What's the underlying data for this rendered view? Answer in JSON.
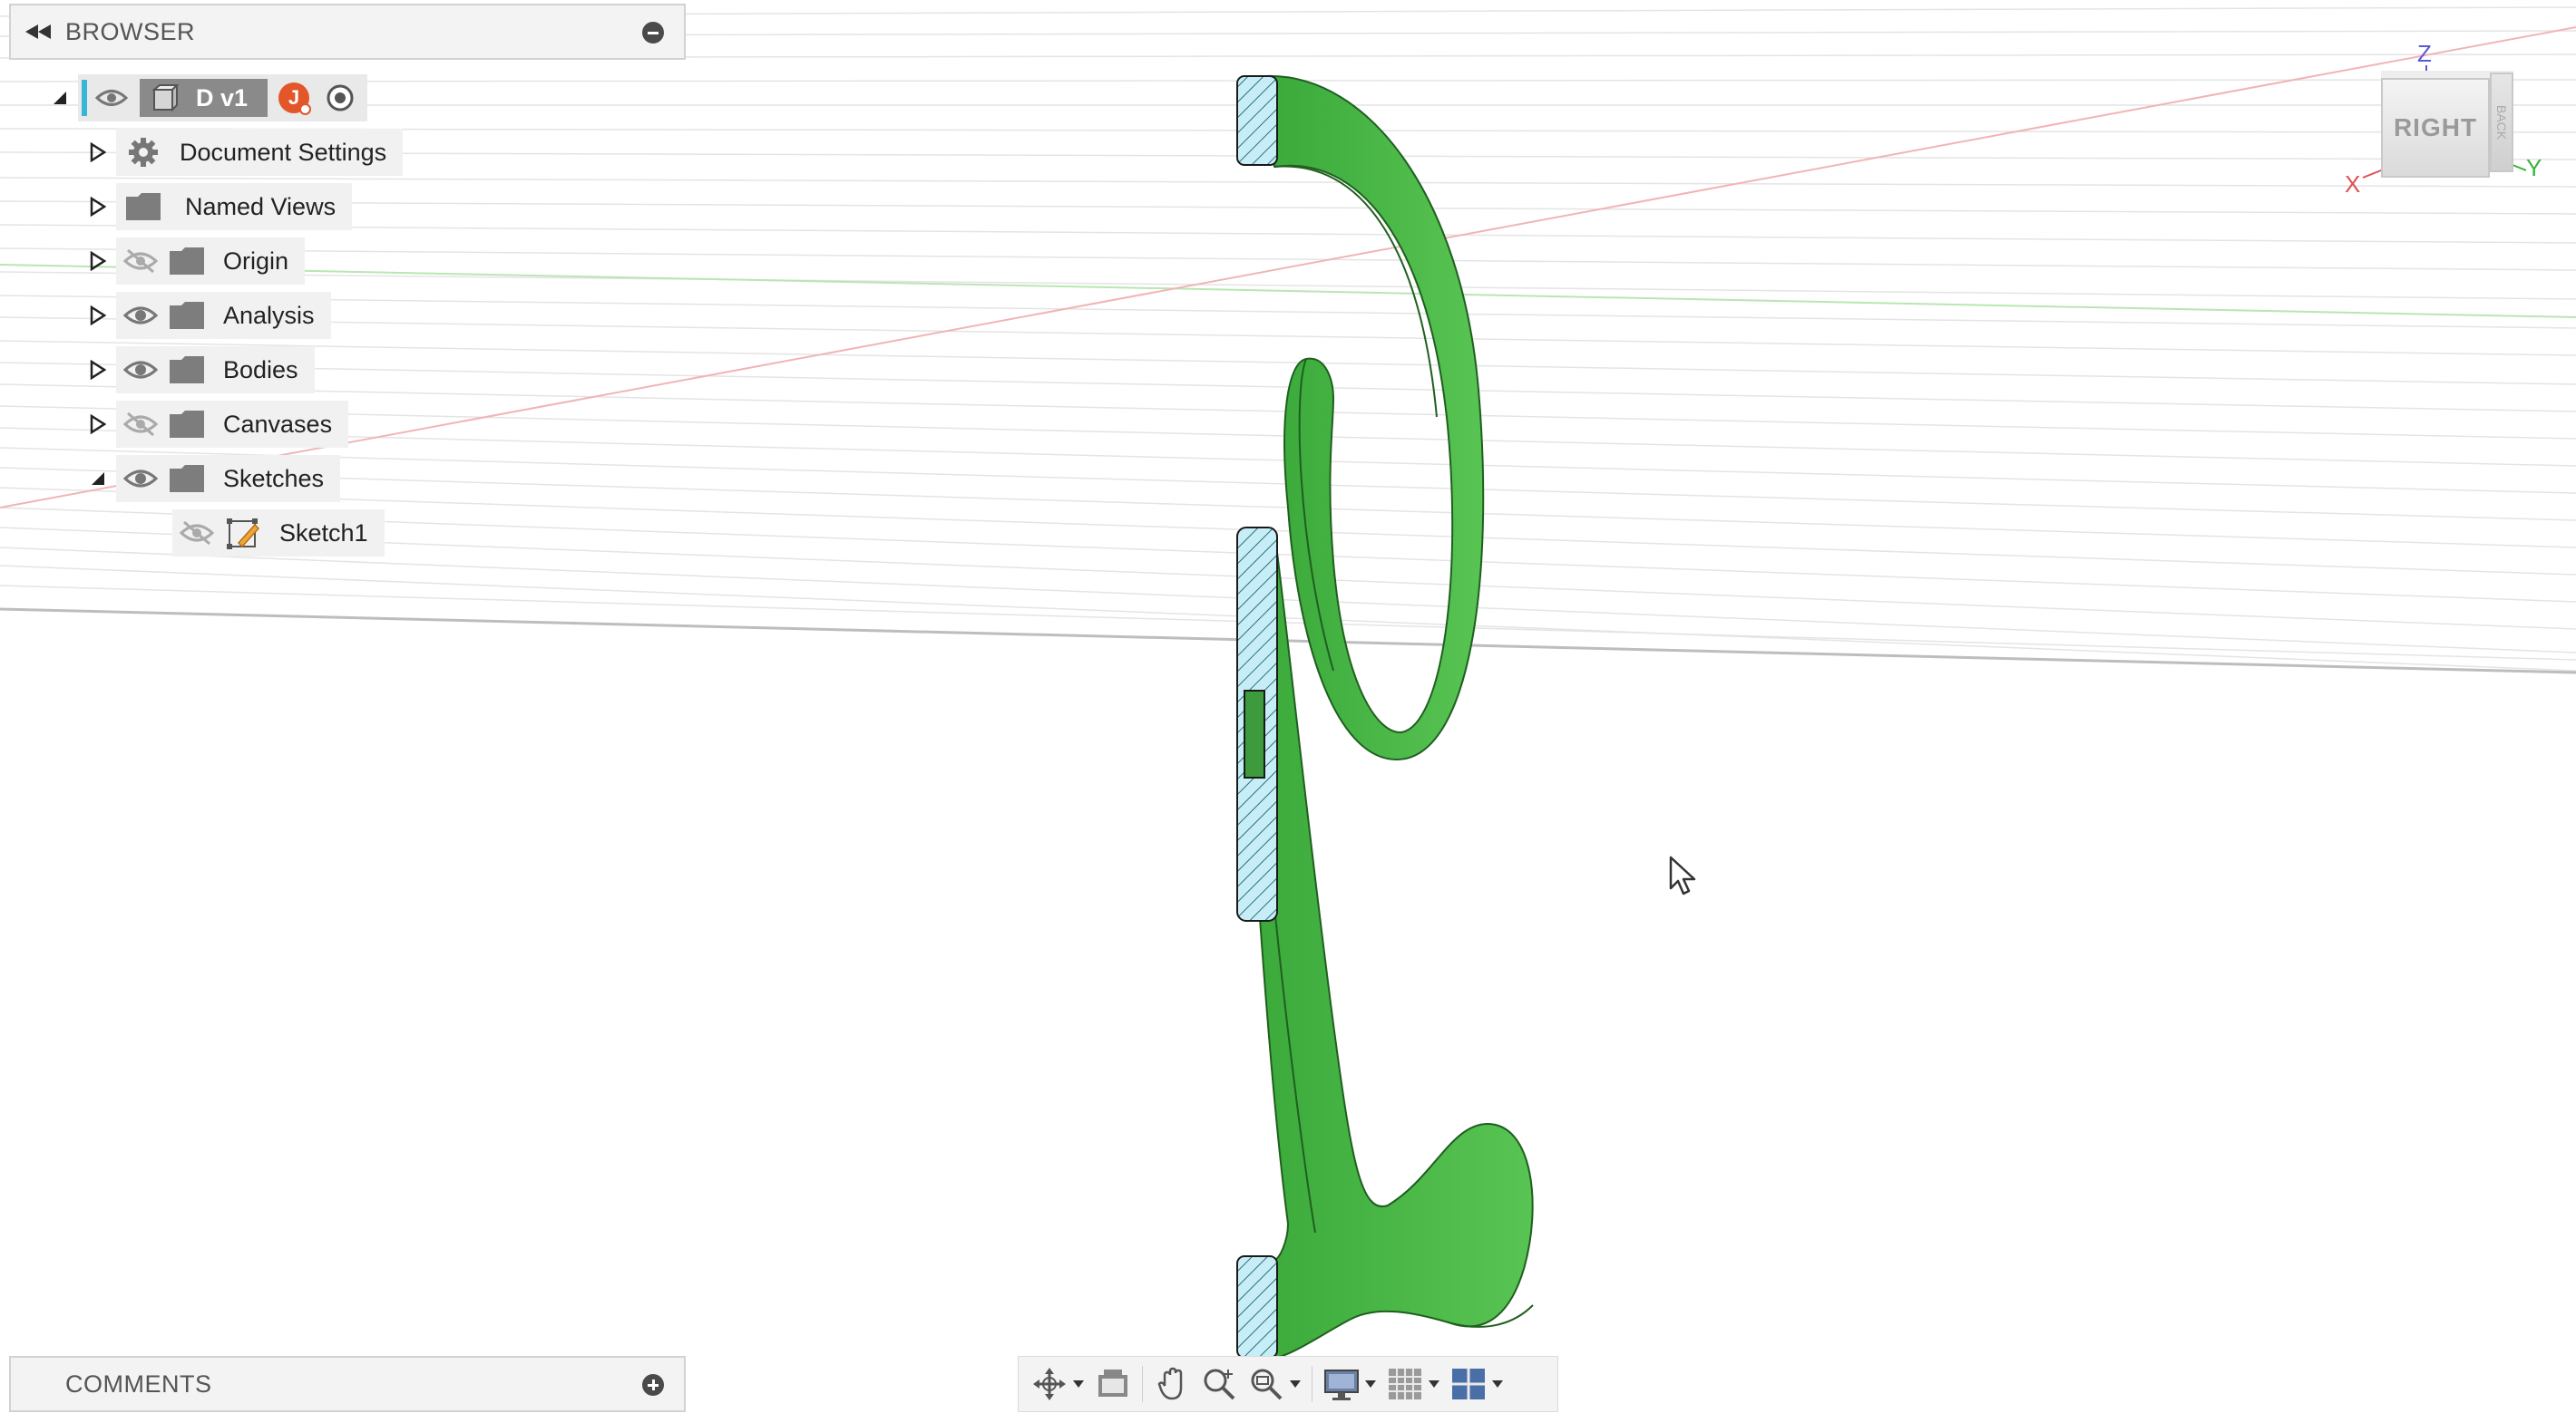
{
  "browser": {
    "title": "BROWSER",
    "root": {
      "name": "D v1",
      "avatar_initial": "J"
    },
    "items": [
      {
        "label": "Document Settings",
        "icon": "gear-icon",
        "visible": null
      },
      {
        "label": "Named Views",
        "icon": "folder-icon",
        "visible": null
      },
      {
        "label": "Origin",
        "icon": "folder-icon",
        "visible": false
      },
      {
        "label": "Analysis",
        "icon": "folder-icon",
        "visible": true
      },
      {
        "label": "Bodies",
        "icon": "folder-icon",
        "visible": true
      },
      {
        "label": "Canvases",
        "icon": "folder-icon",
        "visible": false
      },
      {
        "label": "Sketches",
        "icon": "folder-icon",
        "visible": true,
        "expanded": true
      }
    ],
    "children": [
      {
        "label": "Sketch1",
        "icon": "sketch-icon",
        "visible": false
      }
    ]
  },
  "viewcube": {
    "face_label": "RIGHT",
    "side_label": "BACK",
    "axis_x": "X",
    "axis_y": "Y",
    "axis_z": "Z"
  },
  "comments": {
    "title": "COMMENTS"
  },
  "toolbar": {
    "buttons": [
      "orbit-icon",
      "look-at-icon",
      "pan-icon",
      "zoom-icon",
      "zoom-window-icon",
      "display-settings-icon",
      "grid-icon",
      "viewports-icon"
    ]
  },
  "colors": {
    "model_green": "#4db848",
    "model_dark": "#2a8a2a",
    "section_hatch": "#bfe9f3",
    "accent": "#37b6d9",
    "avatar": "#e2562a"
  }
}
